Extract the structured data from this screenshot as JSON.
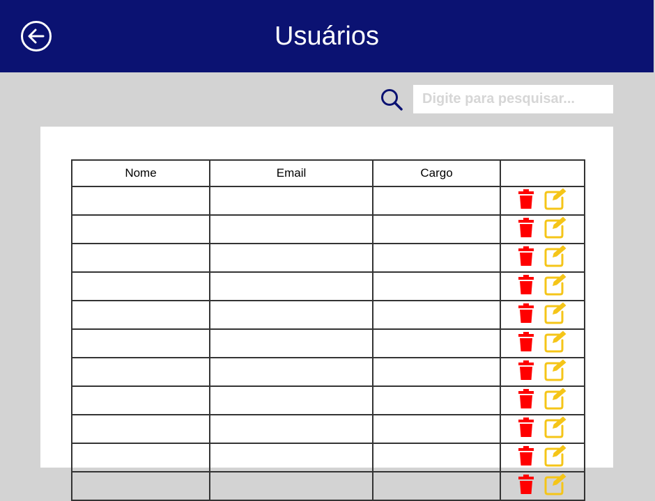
{
  "header": {
    "title": "Usuários",
    "back_icon": "arrow-left-circle-icon",
    "background_color": "#0b1272"
  },
  "search": {
    "icon": "search-icon",
    "placeholder": "Digite para pesquisar...",
    "value": ""
  },
  "table": {
    "columns": [
      "Nome",
      "Email",
      "Cargo",
      ""
    ],
    "rows": [
      {
        "nome": "",
        "email": "",
        "cargo": ""
      },
      {
        "nome": "",
        "email": "",
        "cargo": ""
      },
      {
        "nome": "",
        "email": "",
        "cargo": ""
      },
      {
        "nome": "",
        "email": "",
        "cargo": ""
      },
      {
        "nome": "",
        "email": "",
        "cargo": ""
      },
      {
        "nome": "",
        "email": "",
        "cargo": ""
      },
      {
        "nome": "",
        "email": "",
        "cargo": ""
      },
      {
        "nome": "",
        "email": "",
        "cargo": ""
      },
      {
        "nome": "",
        "email": "",
        "cargo": ""
      },
      {
        "nome": "",
        "email": "",
        "cargo": ""
      },
      {
        "nome": "",
        "email": "",
        "cargo": ""
      }
    ],
    "row_actions": [
      {
        "icon": "trash-icon",
        "color": "#ff0000"
      },
      {
        "icon": "edit-icon",
        "color": "#f5c518"
      }
    ]
  }
}
